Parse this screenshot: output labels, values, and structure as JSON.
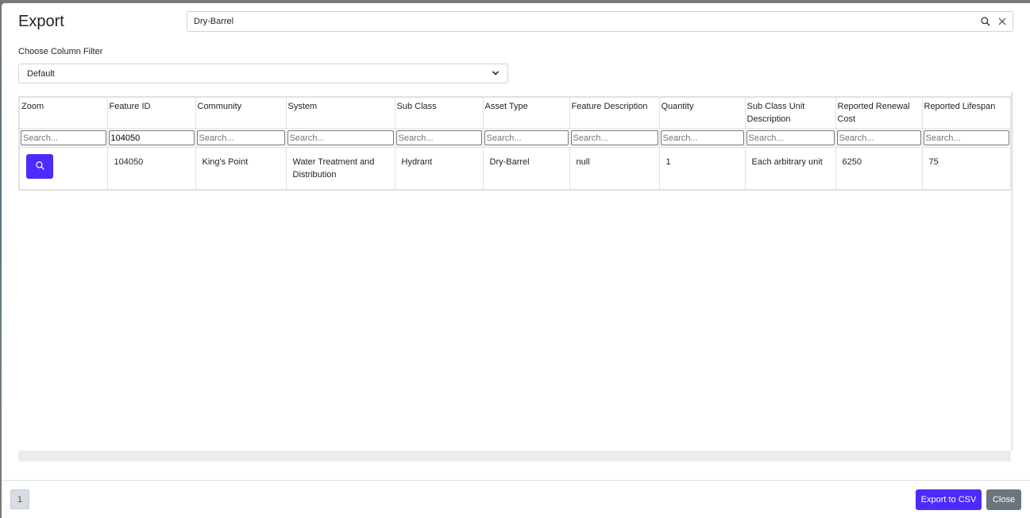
{
  "modal": {
    "title": "Export",
    "search": {
      "value": "Dry-Barrel",
      "search_icon": "search-icon",
      "clear_icon": "close-icon"
    },
    "column_filter": {
      "label": "Choose Column Filter",
      "selected": "Default"
    }
  },
  "table": {
    "columns": [
      "Zoom",
      "Feature ID",
      "Community",
      "System",
      "Sub Class",
      "Asset Type",
      "Feature Description",
      "Quantity",
      "Sub Class Unit Description",
      "Reported Renewal Cost",
      "Reported Lifespan"
    ],
    "filters": {
      "placeholder": "Search...",
      "values": [
        "",
        "104050",
        "",
        "",
        "",
        "",
        "",
        "",
        "",
        "",
        ""
      ]
    },
    "rows": [
      {
        "zoom_icon": "search-icon",
        "feature_id": "104050",
        "community": "King's Point",
        "system": "Water Treatment and Distribution",
        "sub_class": "Hydrant",
        "asset_type": "Dry-Barrel",
        "feature_description": "null",
        "quantity": "1",
        "sub_class_unit_description": "Each arbitrary unit",
        "reported_renewal_cost": "6250",
        "reported_lifespan": "75"
      }
    ]
  },
  "footer": {
    "page": "1",
    "export_label": "Export to CSV",
    "close_label": "Close"
  },
  "colors": {
    "primary": "#4b2cfd",
    "secondary": "#6c757d"
  }
}
